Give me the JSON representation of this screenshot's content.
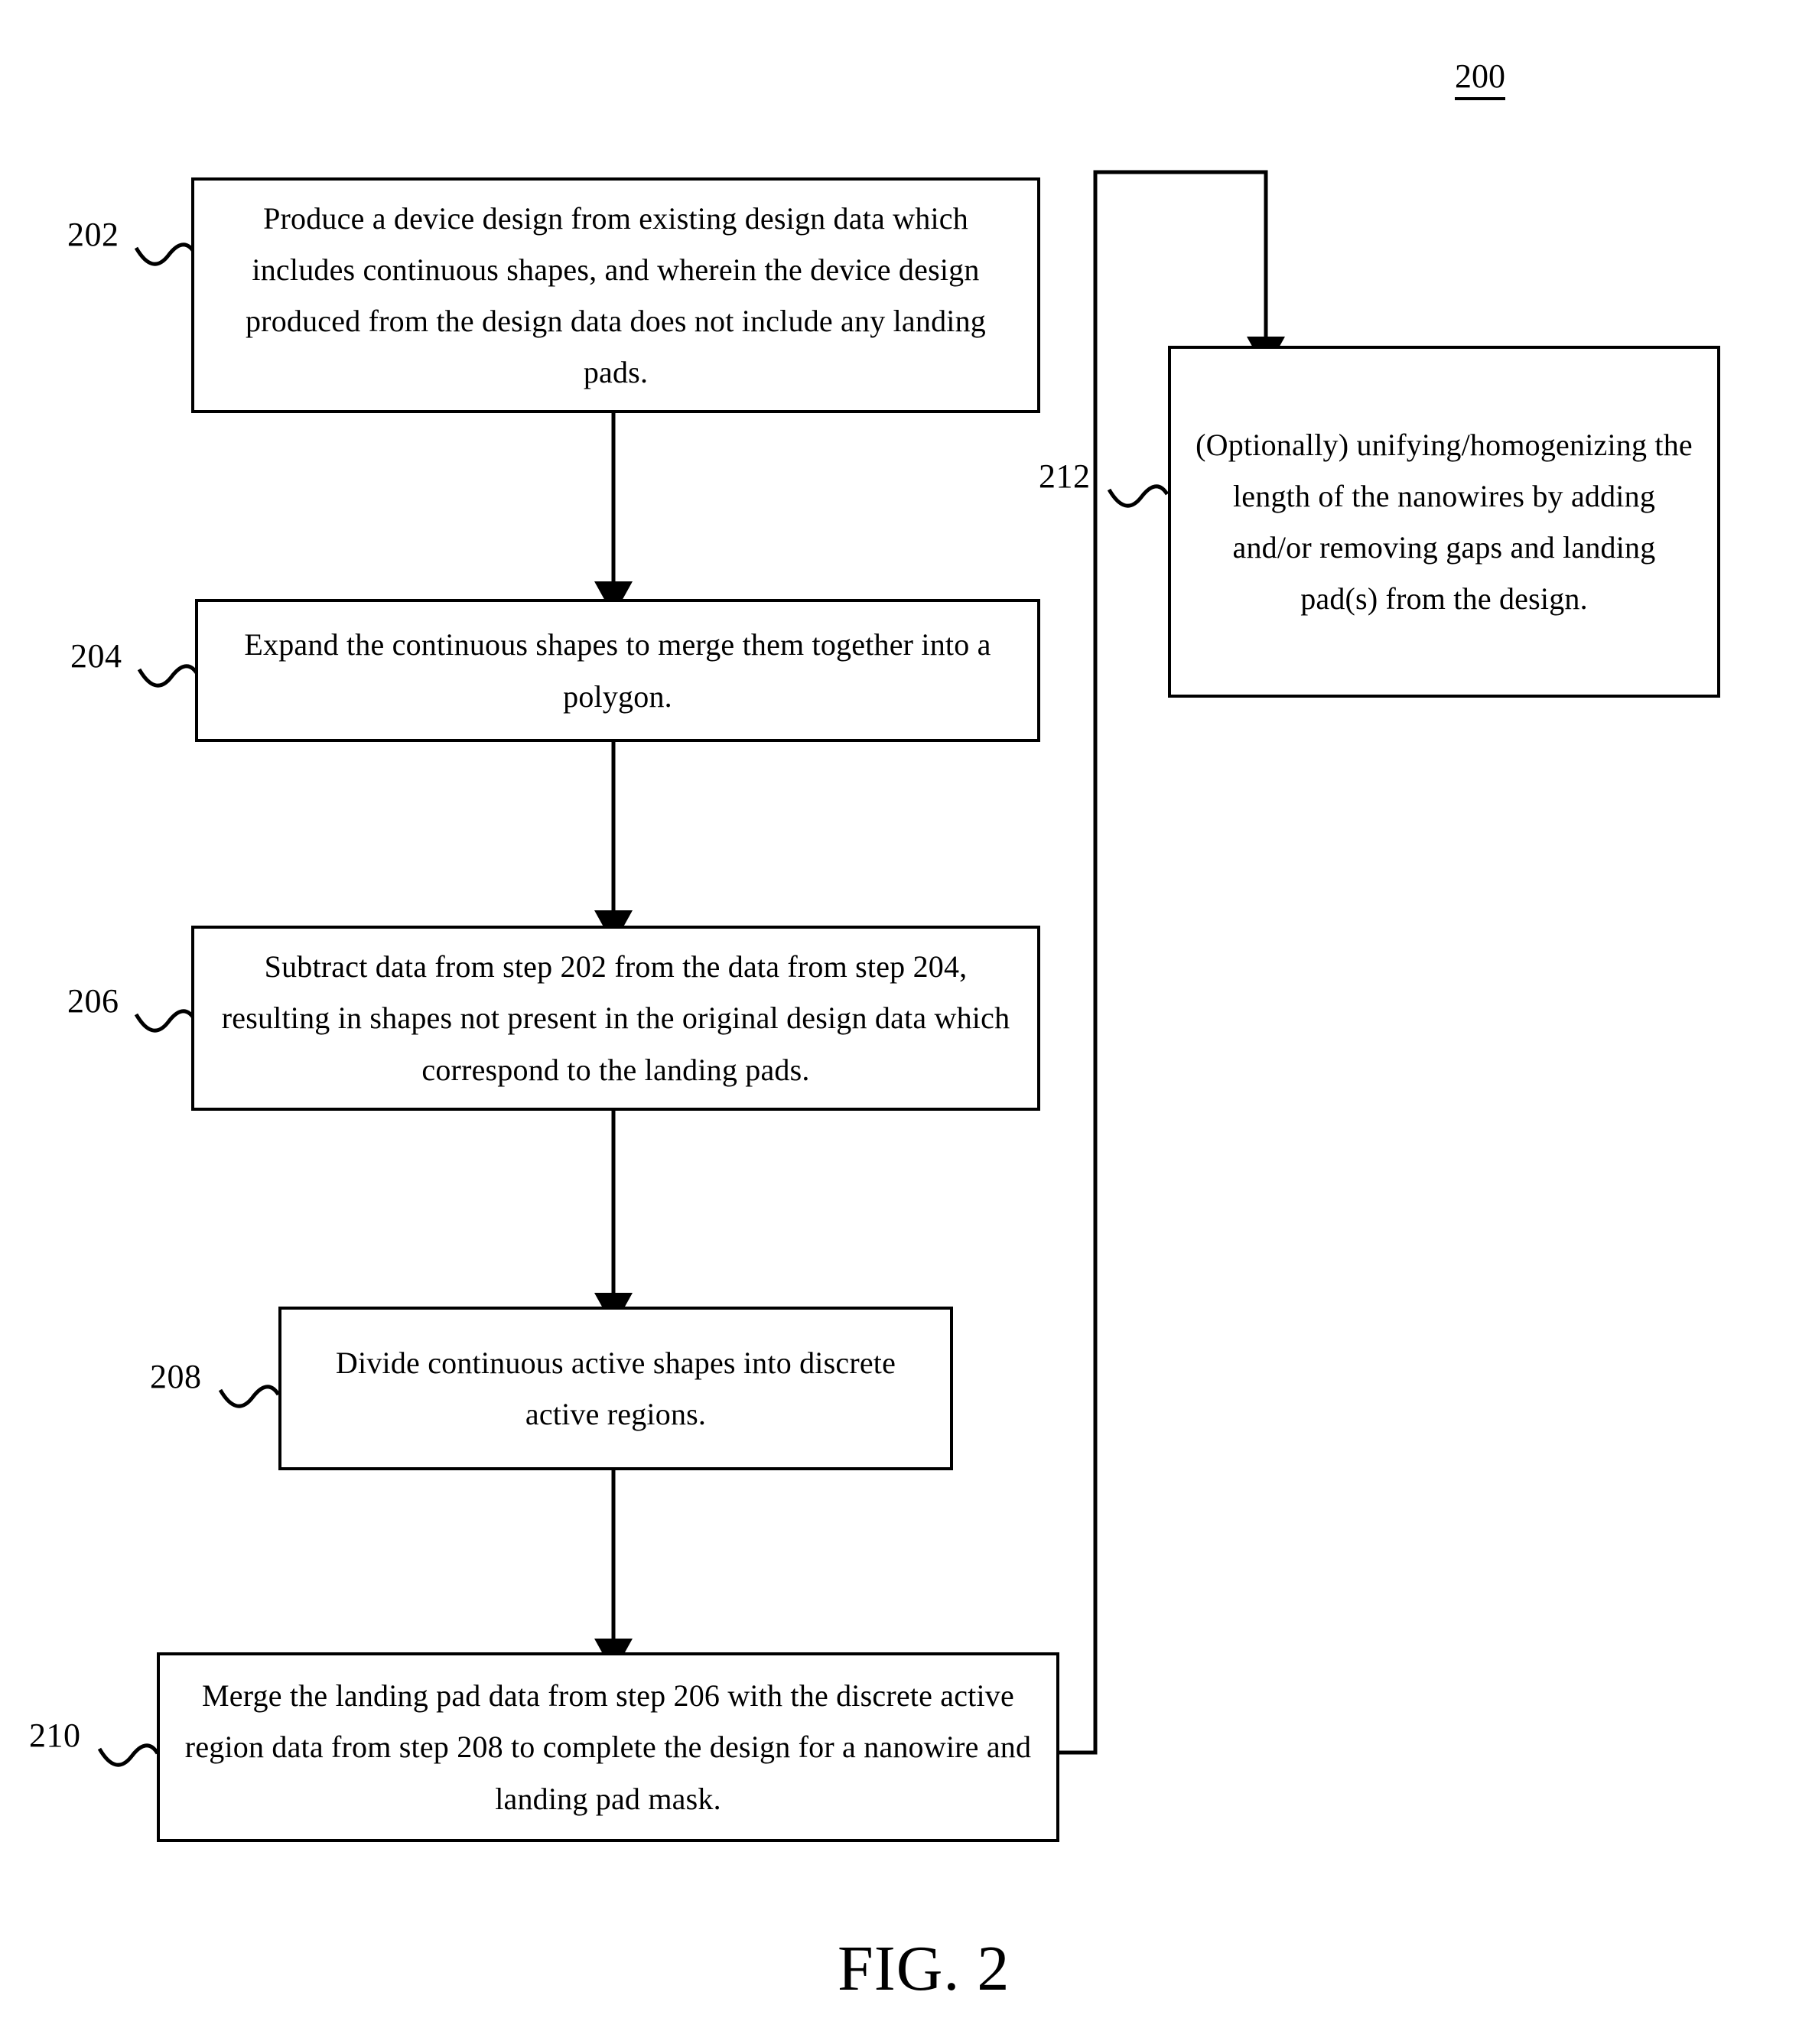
{
  "figure": {
    "identifier": "200",
    "caption": "FIG. 2"
  },
  "steps": [
    {
      "ref": "202",
      "text": "Produce a device design from existing design data which includes continuous shapes, and wherein the device design produced from the design data does not include any landing pads."
    },
    {
      "ref": "204",
      "text": "Expand the continuous shapes to merge them together into a polygon."
    },
    {
      "ref": "206",
      "text": "Subtract data from step 202 from the data from step 204, resulting in shapes not present in the original design data which correspond to the landing pads."
    },
    {
      "ref": "208",
      "text": "Divide continuous active shapes into discrete active regions."
    },
    {
      "ref": "210",
      "text": "Merge the landing pad data from step 206 with the discrete active region data from step 208 to complete the design for a nanowire and landing pad mask."
    },
    {
      "ref": "212",
      "text": "(Optionally) unifying/homogenizing the length of the nanowires by adding and/or removing gaps and landing pad(s) from the design."
    }
  ],
  "colors": {
    "ink": "#000000",
    "paper": "#ffffff"
  }
}
